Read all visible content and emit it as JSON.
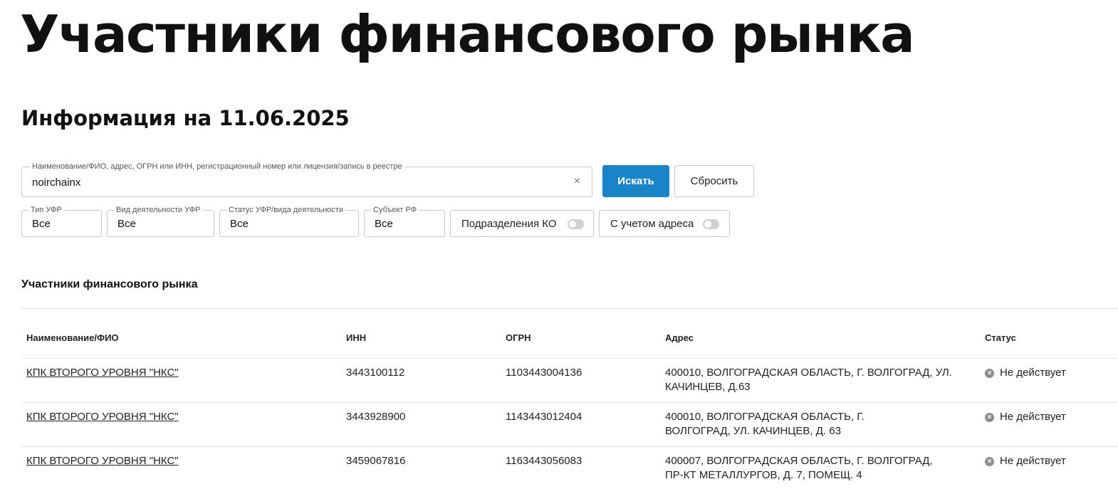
{
  "page": {
    "title": "Участники финансового рынка",
    "info_date": "Информация на 11.06.2025"
  },
  "search": {
    "legend": "Наименование/ФИО, адрес, ОГРН или ИНН, регистрационный номер или лицензия/запись в реестре",
    "value": "noirchainx",
    "clear_symbol": "×",
    "search_label": "Искать",
    "reset_label": "Сбросить"
  },
  "filters": {
    "type": {
      "legend": "Тип УФР",
      "value": "Все"
    },
    "activity": {
      "legend": "Вид деятельности УФР",
      "value": "Все"
    },
    "status": {
      "legend": "Статус УФР/вида деятельности",
      "value": "Все"
    },
    "region": {
      "legend": "Субъект РФ",
      "value": "Все"
    },
    "ko_divisions": {
      "label": "Подразделения КО",
      "enabled": false
    },
    "with_address": {
      "label": "С учетом адреса",
      "enabled": false
    }
  },
  "results": {
    "title": "Участники финансового рынка",
    "columns": [
      "Наименование/ФИО",
      "ИНН",
      "ОГРН",
      "Адрес",
      "Статус"
    ],
    "rows": [
      {
        "name": "КПК ВТОРОГО УРОВНЯ \"НКС\"",
        "inn": "3443100112",
        "ogrn": "1103443004136",
        "address": "400010, ВОЛГОГРАДСКАЯ ОБЛАСТЬ, Г. ВОЛГОГРАД, УЛ. КАЧИНЦЕВ, Д.63",
        "status": "Не действует"
      },
      {
        "name": "КПК ВТОРОГО УРОВНЯ \"НКС\"",
        "inn": "3443928900",
        "ogrn": "1143443012404",
        "address": "400010, ВОЛГОГРАДСКАЯ ОБЛАСТЬ, Г. ВОЛГОГРАД, УЛ. КАЧИНЦЕВ, Д. 63",
        "status": "Не действует"
      },
      {
        "name": "КПК ВТОРОГО УРОВНЯ \"НКС\"",
        "inn": "3459067816",
        "ogrn": "1163443056083",
        "address": "400007, ВОЛГОГРАДСКАЯ ОБЛАСТЬ, Г. ВОЛГОГРАД, ПР-КТ МЕТАЛЛУРГОВ, Д. 7, ПОМЕЩ. 4",
        "status": "Не действует"
      }
    ]
  },
  "colors": {
    "accent": "#1a84c8",
    "status_inactive": "#8e8e8e"
  }
}
